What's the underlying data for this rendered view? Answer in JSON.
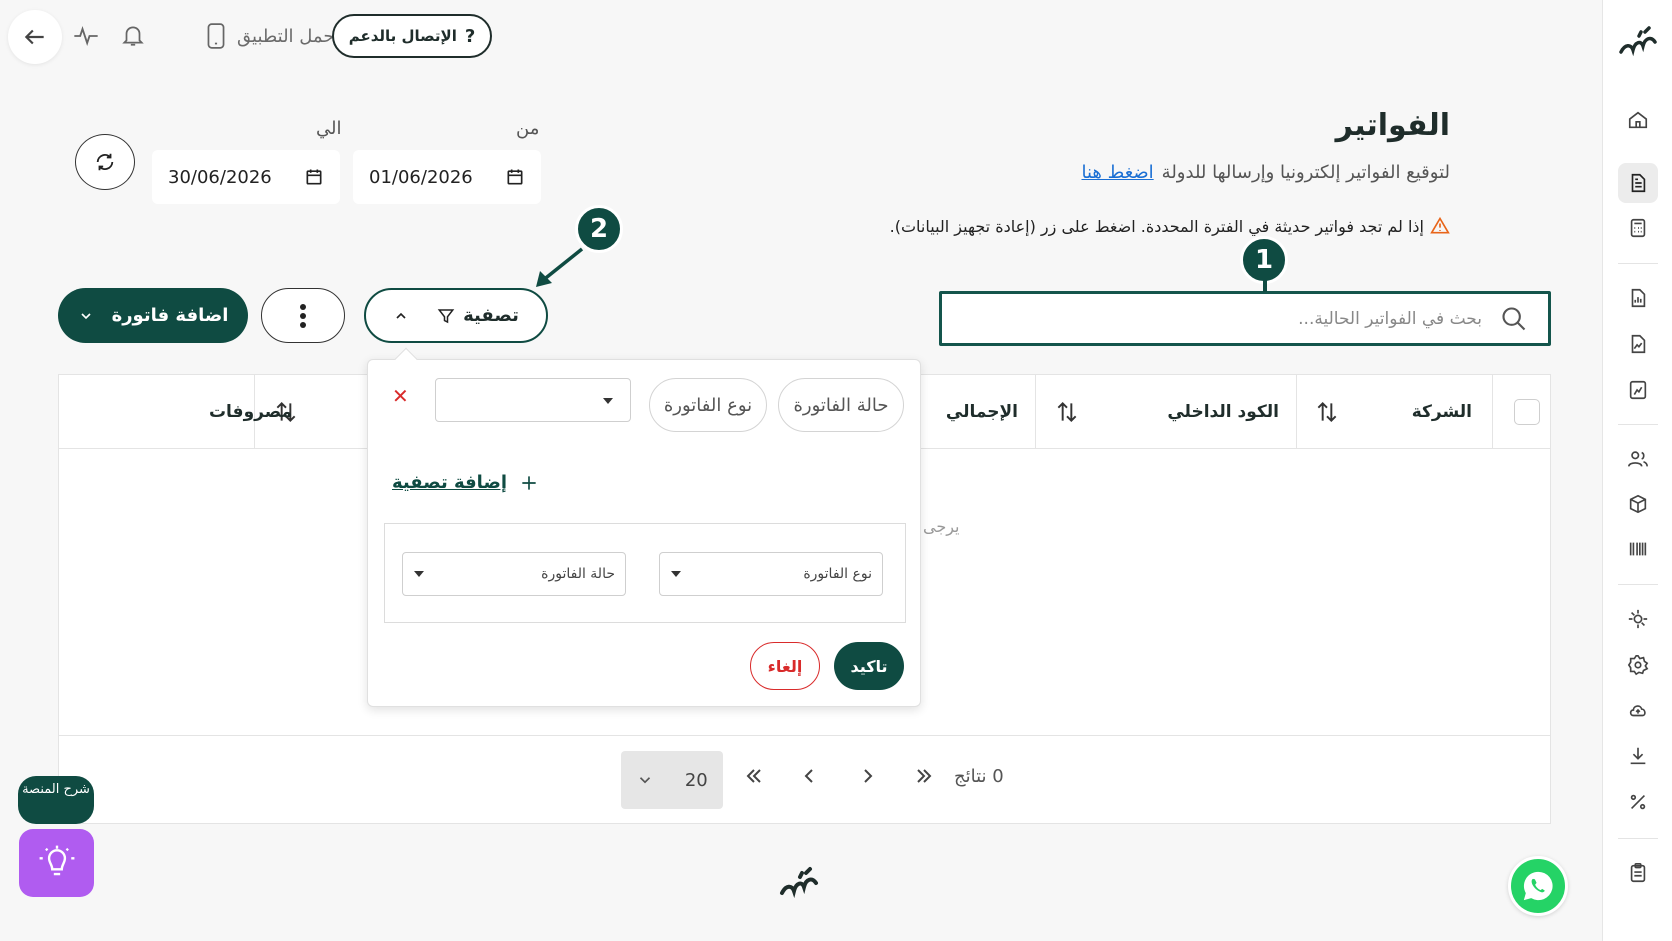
{
  "topbar": {
    "support_label": "الإتصال بالدعم",
    "download_app_label": "حمل التطبيق"
  },
  "header": {
    "title": "الفواتير",
    "subtitle_text": "لتوقيع الفواتير إلكترونيا وإرسالها للدولة",
    "subtitle_link": "اضغط هنا",
    "warning": "إذا لم تجد فواتير حديثة في الفترة المحددة. اضغط على زر (إعادة تجهيز البيانات)."
  },
  "dates": {
    "from_label": "من",
    "from_value": "01/06/2026",
    "to_label": "الي",
    "to_value": "30/06/2026"
  },
  "search": {
    "placeholder": "بحث في الفواتير الحالية..."
  },
  "annotations": {
    "badge_1": "1",
    "badge_2": "2"
  },
  "actions": {
    "add_invoice_label": "اضافة فاتورة",
    "filter_label": "تصفية"
  },
  "table": {
    "columns": [
      "الشركة",
      "الكود الداخلي",
      "الإجمالي",
      "مصروفات"
    ],
    "empty_text_fragment": "يرجى"
  },
  "filter_popup": {
    "chip_status": "حالة الفاتورة",
    "chip_type": "نوع الفاتورة",
    "add_filter_label": "إضافة تصفية",
    "select_type_label": "نوع الفاتورة",
    "select_status_label": "حالة الفاتورة",
    "confirm_label": "تاكيد",
    "cancel_label": "إلغاء"
  },
  "pagination": {
    "results_label": "0 نتائج",
    "page_size": "20"
  },
  "widgets": {
    "explain_label": "شرح المنصة"
  },
  "colors": {
    "brand": "#0f4b42",
    "danger": "#d92b2b",
    "link": "#1a6fd4",
    "bulb": "#b05cf0",
    "whatsapp": "#25d366"
  }
}
